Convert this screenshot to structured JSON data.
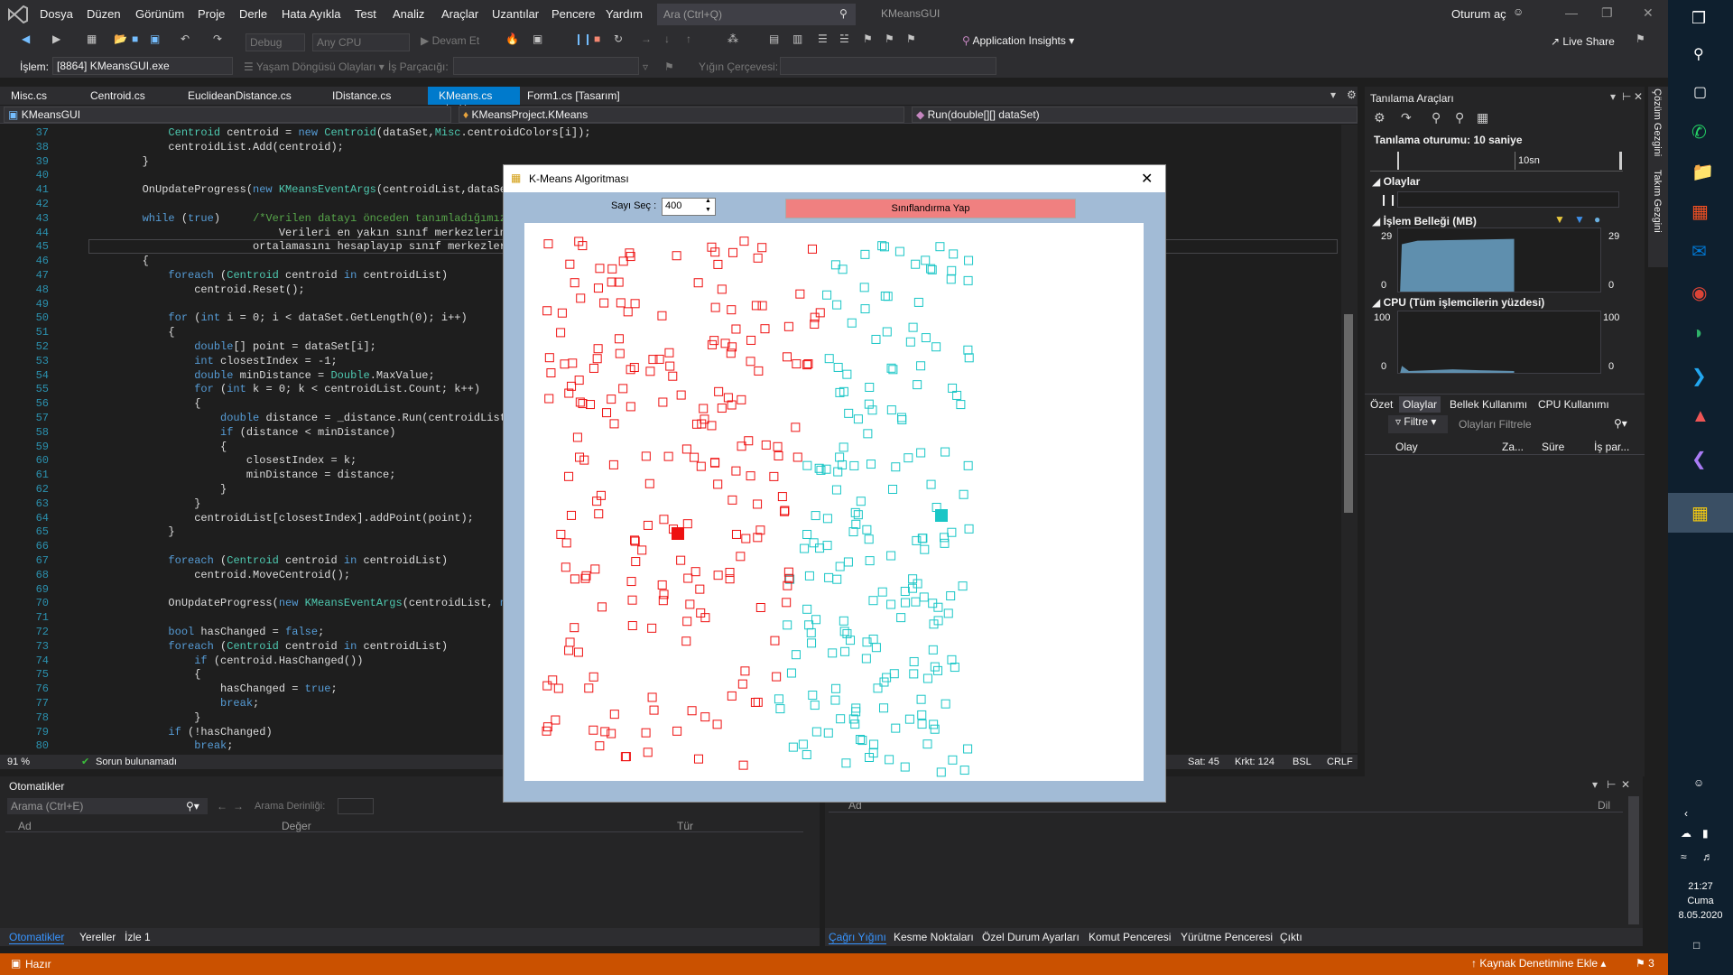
{
  "menu": {
    "items": [
      "Dosya",
      "Düzen",
      "Görünüm",
      "Proje",
      "Derle",
      "Hata Ayıkla",
      "Test",
      "Analiz",
      "Araçlar",
      "Uzantılar",
      "Pencere",
      "Yardım"
    ],
    "search_placeholder": "Ara (Ctrl+Q)",
    "solution_title": "KMeansGUI",
    "signin": "Oturum aç",
    "live_share": "Live Share"
  },
  "toolbar": {
    "config": "Debug",
    "platform": "Any CPU",
    "continue": "Devam Et",
    "app_insights": "Application Insights",
    "process_label": "İşlem:",
    "process_value": "[8864] KMeansGUI.exe",
    "lifecycle": "Yaşam Döngüsü Olayları",
    "thread": "İş Parçacığı:",
    "stack_frame": "Yığın Çerçevesi:"
  },
  "tabs": [
    {
      "label": "Misc.cs",
      "active": false
    },
    {
      "label": "Centroid.cs",
      "active": false
    },
    {
      "label": "EuclideanDistance.cs",
      "active": false
    },
    {
      "label": "IDistance.cs",
      "active": false
    },
    {
      "label": "KMeans.cs",
      "active": true
    },
    {
      "label": "Form1.cs [Tasarım]",
      "active": false
    }
  ],
  "nav": {
    "project": "KMeansGUI",
    "class": "KMeansProject.KMeans",
    "member": "Run(double[][] dataSet)"
  },
  "code_lines": [
    {
      "n": "37",
      "t": "            Centroid centroid = new Centroid(dataSet,Misc.centroidColors[i]);"
    },
    {
      "n": "38",
      "t": "            centroidList.Add(centroid);"
    },
    {
      "n": "39",
      "t": "        }"
    },
    {
      "n": "40",
      "t": ""
    },
    {
      "n": "41",
      "t": "        OnUpdateProgress(new KMeansEventArgs(centroidList,dataSet));"
    },
    {
      "n": "42",
      "t": ""
    },
    {
      "n": "43",
      "t": "        while (true)     /*Verilen datayı önceden tanımladığımız  k"
    },
    {
      "n": "44",
      "t": "                             Verileri en yakın sınıf merkezlerine"
    },
    {
      "n": "45",
      "t": "                         ortalamasını hesaplayıp sınıf merkezlerini"
    },
    {
      "n": "46",
      "t": "        {"
    },
    {
      "n": "47",
      "t": "            foreach (Centroid centroid in centroidList)"
    },
    {
      "n": "48",
      "t": "                centroid.Reset();"
    },
    {
      "n": "49",
      "t": ""
    },
    {
      "n": "50",
      "t": "            for (int i = 0; i < dataSet.GetLength(0); i++)"
    },
    {
      "n": "51",
      "t": "            {"
    },
    {
      "n": "52",
      "t": "                double[] point = dataSet[i];"
    },
    {
      "n": "53",
      "t": "                int closestIndex = -1;"
    },
    {
      "n": "54",
      "t": "                double minDistance = Double.MaxValue;"
    },
    {
      "n": "55",
      "t": "                for (int k = 0; k < centroidList.Count; k++)"
    },
    {
      "n": "56",
      "t": "                {"
    },
    {
      "n": "57",
      "t": "                    double distance = _distance.Run(centroidList[k]."
    },
    {
      "n": "58",
      "t": "                    if (distance < minDistance)"
    },
    {
      "n": "59",
      "t": "                    {"
    },
    {
      "n": "60",
      "t": "                        closestIndex = k;"
    },
    {
      "n": "61",
      "t": "                        minDistance = distance;"
    },
    {
      "n": "62",
      "t": "                    }"
    },
    {
      "n": "63",
      "t": "                }"
    },
    {
      "n": "64",
      "t": "                centroidList[closestIndex].addPoint(point);"
    },
    {
      "n": "65",
      "t": "            }"
    },
    {
      "n": "66",
      "t": ""
    },
    {
      "n": "67",
      "t": "            foreach (Centroid centroid in centroidList)"
    },
    {
      "n": "68",
      "t": "                centroid.MoveCentroid();"
    },
    {
      "n": "69",
      "t": ""
    },
    {
      "n": "70",
      "t": "            OnUpdateProgress(new KMeansEventArgs(centroidList, null)"
    },
    {
      "n": "71",
      "t": ""
    },
    {
      "n": "72",
      "t": "            bool hasChanged = false;"
    },
    {
      "n": "73",
      "t": "            foreach (Centroid centroid in centroidList)"
    },
    {
      "n": "74",
      "t": "                if (centroid.HasChanged())"
    },
    {
      "n": "75",
      "t": "                {"
    },
    {
      "n": "76",
      "t": "                    hasChanged = true;"
    },
    {
      "n": "77",
      "t": "                    break;"
    },
    {
      "n": "78",
      "t": "                }"
    },
    {
      "n": "79",
      "t": "            if (!hasChanged)"
    },
    {
      "n": "80",
      "t": "                break;"
    },
    {
      "n": "81",
      "t": "        }"
    }
  ],
  "editor_status": {
    "zoom": "91 %",
    "issues": "Sorun bulunamadı",
    "line": "Sat: 45",
    "char": "Krkt: 124",
    "whitespace": "BSL",
    "eol": "CRLF"
  },
  "diag": {
    "title": "Tanılama Araçları",
    "session": "Tanılama oturumu: 10 saniye",
    "time_label": "10sn",
    "events": "Olaylar",
    "memory": "İşlem Belleği (MB)",
    "mem_top": "29",
    "mem_bottom": "0",
    "cpu": "CPU (Tüm işlemcilerin yüzdesi)",
    "cpu_top": "100",
    "cpu_bottom": "0",
    "tabs": [
      "Özet",
      "Olaylar",
      "Bellek Kullanımı",
      "CPU Kullanımı"
    ],
    "filter": "Filtre",
    "filter_placeholder": "Olayları Filtrele",
    "columns": [
      "Olay",
      "Za...",
      "Süre",
      "İş par..."
    ]
  },
  "side_tabs": [
    "Çözüm Gezgini",
    "Takım Gezgini"
  ],
  "autos": {
    "title": "Otomatikler",
    "search_placeholder": "Arama (Ctrl+E)",
    "depth": "Arama Derinliği:",
    "columns": [
      "Ad",
      "Değer",
      "Tür"
    ],
    "bottom_tabs": [
      "Otomatikler",
      "Yereller",
      "İzle 1"
    ]
  },
  "callstack": {
    "columns": [
      "Ad",
      "Dil"
    ],
    "bottom_tabs": [
      "Çağrı Yığını",
      "Kesme Noktaları",
      "Özel Durum Ayarları",
      "Komut Penceresi",
      "Yürütme Penceresi",
      "Çıktı"
    ]
  },
  "status": {
    "ready": "Hazır",
    "source_control": "Kaynak Denetimine Ekle",
    "notifications": "3"
  },
  "taskbar": {
    "time": "21:27",
    "day": "Cuma",
    "date": "8.05.2020"
  },
  "dialog": {
    "title": "K-Means Algoritması",
    "count_label": "Sayı Seç :",
    "count_value": "400",
    "classify_button": "Sınıflandırma Yap"
  },
  "colors": {
    "accent": "#007acc",
    "status": "#ca5100",
    "cluster_red": "#ee1111",
    "cluster_cyan": "#19c6c6"
  }
}
